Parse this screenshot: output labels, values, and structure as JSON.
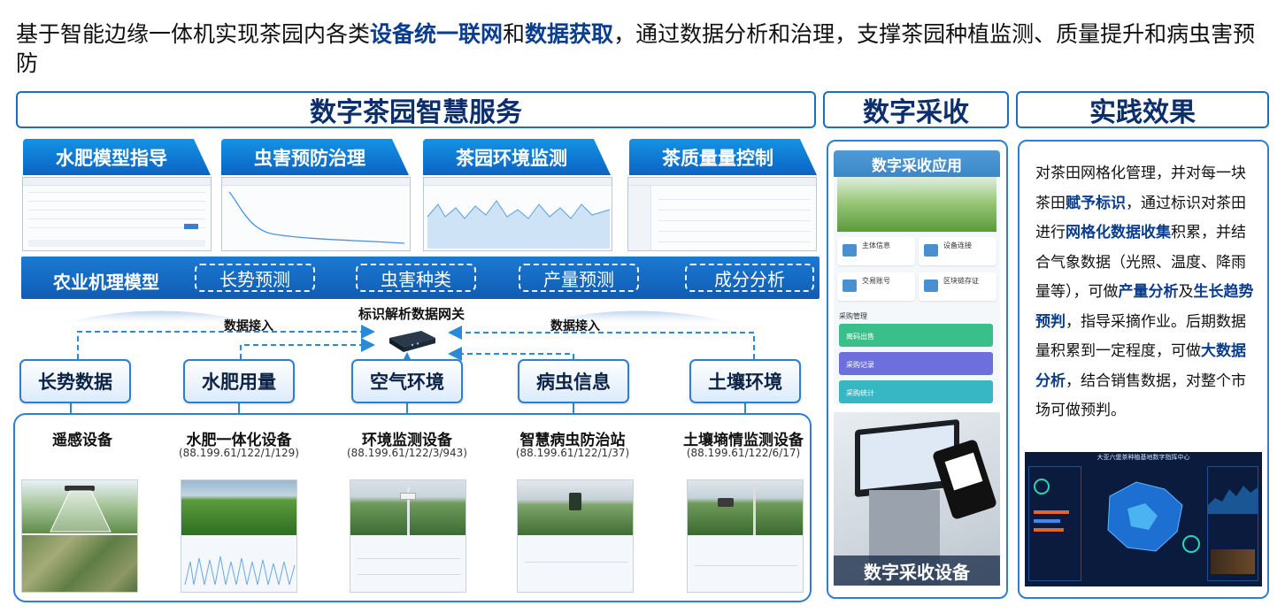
{
  "headline": {
    "part1": "基于智能边缘一体机实现茶园内各类",
    "bold1": "设备统一联网",
    "part2": "和",
    "bold2": "数据获取",
    "part3": "，通过数据分析和治理，支撑茶园种植监测、质量提升和病虫害预防"
  },
  "sections": {
    "service_title": "数字茶园智慧服务",
    "harvest_title": "数字采收",
    "effect_title": "实践效果"
  },
  "services": [
    {
      "label": "水肥模型指导"
    },
    {
      "label": "虫害预防治理"
    },
    {
      "label": "茶园环境监测"
    },
    {
      "label": "茶质量量控制"
    }
  ],
  "model": {
    "name": "农业机理模型",
    "predictions": [
      "长势预测",
      "虫害种类",
      "产量预测",
      "成分分析"
    ]
  },
  "gateway": {
    "label": "标识解析数据网关",
    "left_in": "数据接入",
    "right_in": "数据接入"
  },
  "data_types": [
    "长势数据",
    "水肥用量",
    "空气环境",
    "病虫信息",
    "土壤环境"
  ],
  "devices": [
    {
      "name": "遥感设备",
      "id": ""
    },
    {
      "name": "水肥一体化设备",
      "id": "(88.199.61/122/1/129)"
    },
    {
      "name": "环境监测设备",
      "id": "(88.199.61/122/3/943)"
    },
    {
      "name": "智慧病虫防治站",
      "id": "(88.199.61/122/1/37)"
    },
    {
      "name": "土壤墒情监测设备",
      "id": "(88.199.61/122/6/17)"
    }
  ],
  "harvest": {
    "app_title": "数字采收应用",
    "device_label": "数字采收设备",
    "section": "采购管理",
    "cards": [
      "主体信息",
      "设备连接",
      "交易账号",
      "区块链存证"
    ],
    "buttons": [
      "离码出售",
      "采购记录",
      "采购统计"
    ]
  },
  "effect": {
    "t1": "对茶田网格化管理，并对每一块茶田",
    "b1": "赋予标识",
    "t2": "，通过标识对茶田进行",
    "b2": "网格化数据收集",
    "t3": "积累，并结合气象数据（光照、温度、降雨量等），可做",
    "b3": "产量分析",
    "t4": "及",
    "b4": "生长趋势预判",
    "t5": "，指导采摘作业。后期数据量积累到一定程度，可做",
    "b5": "大数据分析",
    "t6": "，结合销售数据，对整个市场可做预判。",
    "dashboard_title": "大亚六堡茶种植基地数字指挥中心"
  },
  "colors": {
    "accent": "#1c6fc0",
    "tab_blue": "#0b63c4",
    "heading_navy": "#0c2e6b",
    "highlight_navy": "#0a3d8f",
    "connector": "#2b8ad8"
  }
}
